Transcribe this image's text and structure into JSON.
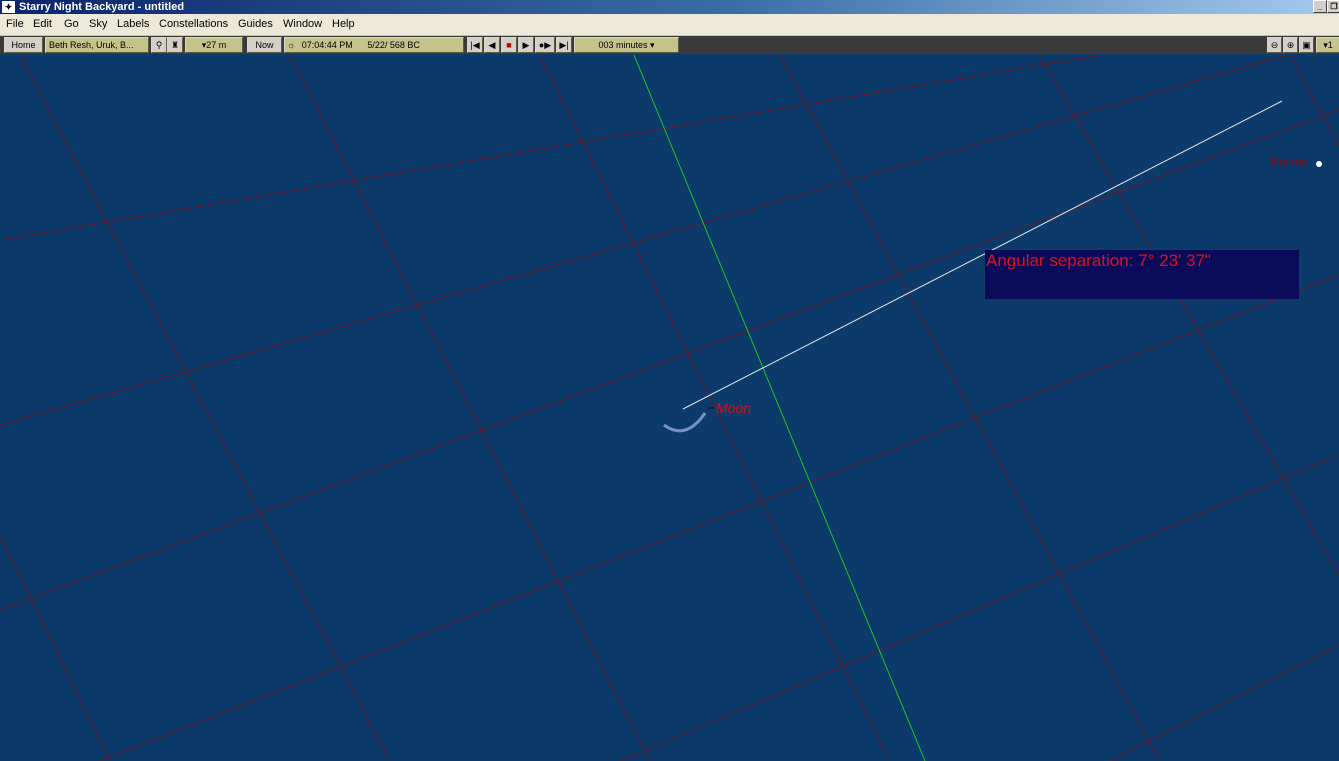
{
  "window": {
    "title": "Starry Night Backyard - untitled",
    "minimize_glyph": "_",
    "restore_glyph": "❐"
  },
  "menu": [
    "File",
    "Edit",
    "Go",
    "Sky",
    "Labels",
    "Constellations",
    "Guides",
    "Window",
    "Help"
  ],
  "toolbar": {
    "home_label": "Home",
    "location": "Beth Resh, Uruk, B...",
    "elevation": "▾27 m",
    "now_label": "Now",
    "time": "07:04:44 PM",
    "date": "5/22/  568 BC",
    "time_step": "003 minutes",
    "time_step_arrow": "▾",
    "zoom_right": "▾1"
  },
  "sky": {
    "moon_label": "Moon",
    "star_label": "Polaris",
    "angular_separation": "Angular separation: 7° 23' 37\""
  },
  "colors": {
    "sky_bg": "#0b3a6b",
    "grid_line": "#6a1a2a",
    "meridian": "#22c422",
    "measure_line": "#e8e8e8",
    "label_red": "#d01020"
  }
}
